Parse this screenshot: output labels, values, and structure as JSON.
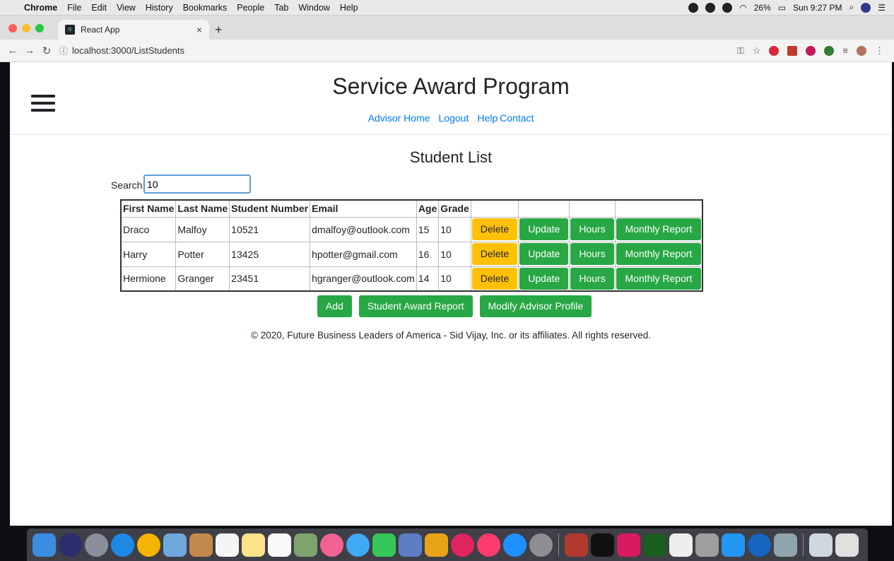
{
  "menubar": {
    "app": "Chrome",
    "items": [
      "File",
      "Edit",
      "View",
      "History",
      "Bookmarks",
      "People",
      "Tab",
      "Window",
      "Help"
    ],
    "battery": "26%",
    "clock": "Sun 9:27 PM"
  },
  "browser": {
    "tab_title": "React App",
    "url": "localhost:3000/ListStudents"
  },
  "page": {
    "title": "Service Award Program",
    "nav": [
      "Advisor Home",
      "Logout",
      "Help",
      "Contact"
    ],
    "heading": "Student List",
    "search": {
      "label": "Search:",
      "value": "10"
    },
    "table": {
      "columns": [
        "First Name",
        "Last Name",
        "Student Number",
        "Email",
        "Age",
        "Grade",
        "",
        "",
        "",
        ""
      ],
      "rows": [
        {
          "first": "Draco",
          "last": "Malfoy",
          "number": "10521",
          "email": "dmalfoy@outlook.com",
          "age": "15",
          "grade": "10"
        },
        {
          "first": "Harry",
          "last": "Potter",
          "number": "13425",
          "email": "hpotter@gmail.com",
          "age": "16",
          "grade": "10"
        },
        {
          "first": "Hermione",
          "last": "Granger",
          "number": "23451",
          "email": "hgranger@outlook.com",
          "age": "14",
          "grade": "10"
        }
      ],
      "row_actions": {
        "delete": "Delete",
        "update": "Update",
        "hours": "Hours",
        "report": "Monthly Report"
      }
    },
    "actions": {
      "add": "Add",
      "award_report": "Student Award Report",
      "modify_profile": "Modify Advisor Profile"
    },
    "footer": "© 2020, Future Business Leaders of America - Sid Vijay, Inc. or its affiliates. All rights reserved."
  },
  "colors": {
    "link": "#007bff",
    "button_green": "#28a745",
    "button_warning": "#ffc107"
  }
}
